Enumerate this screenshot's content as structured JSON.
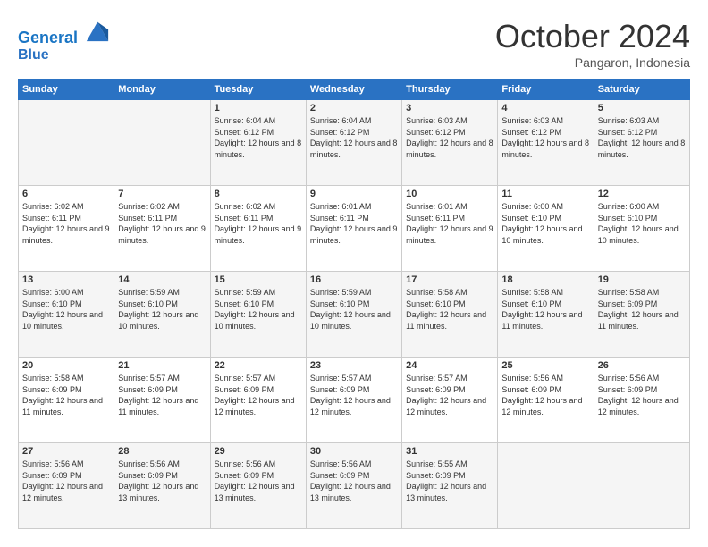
{
  "header": {
    "logo_line1": "General",
    "logo_line2": "Blue",
    "month": "October 2024",
    "location": "Pangaron, Indonesia"
  },
  "days_of_week": [
    "Sunday",
    "Monday",
    "Tuesday",
    "Wednesday",
    "Thursday",
    "Friday",
    "Saturday"
  ],
  "weeks": [
    [
      {
        "day": "",
        "sunrise": "",
        "sunset": "",
        "daylight": ""
      },
      {
        "day": "",
        "sunrise": "",
        "sunset": "",
        "daylight": ""
      },
      {
        "day": "1",
        "sunrise": "Sunrise: 6:04 AM",
        "sunset": "Sunset: 6:12 PM",
        "daylight": "Daylight: 12 hours and 8 minutes."
      },
      {
        "day": "2",
        "sunrise": "Sunrise: 6:04 AM",
        "sunset": "Sunset: 6:12 PM",
        "daylight": "Daylight: 12 hours and 8 minutes."
      },
      {
        "day": "3",
        "sunrise": "Sunrise: 6:03 AM",
        "sunset": "Sunset: 6:12 PM",
        "daylight": "Daylight: 12 hours and 8 minutes."
      },
      {
        "day": "4",
        "sunrise": "Sunrise: 6:03 AM",
        "sunset": "Sunset: 6:12 PM",
        "daylight": "Daylight: 12 hours and 8 minutes."
      },
      {
        "day": "5",
        "sunrise": "Sunrise: 6:03 AM",
        "sunset": "Sunset: 6:12 PM",
        "daylight": "Daylight: 12 hours and 8 minutes."
      }
    ],
    [
      {
        "day": "6",
        "sunrise": "Sunrise: 6:02 AM",
        "sunset": "Sunset: 6:11 PM",
        "daylight": "Daylight: 12 hours and 9 minutes."
      },
      {
        "day": "7",
        "sunrise": "Sunrise: 6:02 AM",
        "sunset": "Sunset: 6:11 PM",
        "daylight": "Daylight: 12 hours and 9 minutes."
      },
      {
        "day": "8",
        "sunrise": "Sunrise: 6:02 AM",
        "sunset": "Sunset: 6:11 PM",
        "daylight": "Daylight: 12 hours and 9 minutes."
      },
      {
        "day": "9",
        "sunrise": "Sunrise: 6:01 AM",
        "sunset": "Sunset: 6:11 PM",
        "daylight": "Daylight: 12 hours and 9 minutes."
      },
      {
        "day": "10",
        "sunrise": "Sunrise: 6:01 AM",
        "sunset": "Sunset: 6:11 PM",
        "daylight": "Daylight: 12 hours and 9 minutes."
      },
      {
        "day": "11",
        "sunrise": "Sunrise: 6:00 AM",
        "sunset": "Sunset: 6:10 PM",
        "daylight": "Daylight: 12 hours and 10 minutes."
      },
      {
        "day": "12",
        "sunrise": "Sunrise: 6:00 AM",
        "sunset": "Sunset: 6:10 PM",
        "daylight": "Daylight: 12 hours and 10 minutes."
      }
    ],
    [
      {
        "day": "13",
        "sunrise": "Sunrise: 6:00 AM",
        "sunset": "Sunset: 6:10 PM",
        "daylight": "Daylight: 12 hours and 10 minutes."
      },
      {
        "day": "14",
        "sunrise": "Sunrise: 5:59 AM",
        "sunset": "Sunset: 6:10 PM",
        "daylight": "Daylight: 12 hours and 10 minutes."
      },
      {
        "day": "15",
        "sunrise": "Sunrise: 5:59 AM",
        "sunset": "Sunset: 6:10 PM",
        "daylight": "Daylight: 12 hours and 10 minutes."
      },
      {
        "day": "16",
        "sunrise": "Sunrise: 5:59 AM",
        "sunset": "Sunset: 6:10 PM",
        "daylight": "Daylight: 12 hours and 10 minutes."
      },
      {
        "day": "17",
        "sunrise": "Sunrise: 5:58 AM",
        "sunset": "Sunset: 6:10 PM",
        "daylight": "Daylight: 12 hours and 11 minutes."
      },
      {
        "day": "18",
        "sunrise": "Sunrise: 5:58 AM",
        "sunset": "Sunset: 6:10 PM",
        "daylight": "Daylight: 12 hours and 11 minutes."
      },
      {
        "day": "19",
        "sunrise": "Sunrise: 5:58 AM",
        "sunset": "Sunset: 6:09 PM",
        "daylight": "Daylight: 12 hours and 11 minutes."
      }
    ],
    [
      {
        "day": "20",
        "sunrise": "Sunrise: 5:58 AM",
        "sunset": "Sunset: 6:09 PM",
        "daylight": "Daylight: 12 hours and 11 minutes."
      },
      {
        "day": "21",
        "sunrise": "Sunrise: 5:57 AM",
        "sunset": "Sunset: 6:09 PM",
        "daylight": "Daylight: 12 hours and 11 minutes."
      },
      {
        "day": "22",
        "sunrise": "Sunrise: 5:57 AM",
        "sunset": "Sunset: 6:09 PM",
        "daylight": "Daylight: 12 hours and 12 minutes."
      },
      {
        "day": "23",
        "sunrise": "Sunrise: 5:57 AM",
        "sunset": "Sunset: 6:09 PM",
        "daylight": "Daylight: 12 hours and 12 minutes."
      },
      {
        "day": "24",
        "sunrise": "Sunrise: 5:57 AM",
        "sunset": "Sunset: 6:09 PM",
        "daylight": "Daylight: 12 hours and 12 minutes."
      },
      {
        "day": "25",
        "sunrise": "Sunrise: 5:56 AM",
        "sunset": "Sunset: 6:09 PM",
        "daylight": "Daylight: 12 hours and 12 minutes."
      },
      {
        "day": "26",
        "sunrise": "Sunrise: 5:56 AM",
        "sunset": "Sunset: 6:09 PM",
        "daylight": "Daylight: 12 hours and 12 minutes."
      }
    ],
    [
      {
        "day": "27",
        "sunrise": "Sunrise: 5:56 AM",
        "sunset": "Sunset: 6:09 PM",
        "daylight": "Daylight: 12 hours and 12 minutes."
      },
      {
        "day": "28",
        "sunrise": "Sunrise: 5:56 AM",
        "sunset": "Sunset: 6:09 PM",
        "daylight": "Daylight: 12 hours and 13 minutes."
      },
      {
        "day": "29",
        "sunrise": "Sunrise: 5:56 AM",
        "sunset": "Sunset: 6:09 PM",
        "daylight": "Daylight: 12 hours and 13 minutes."
      },
      {
        "day": "30",
        "sunrise": "Sunrise: 5:56 AM",
        "sunset": "Sunset: 6:09 PM",
        "daylight": "Daylight: 12 hours and 13 minutes."
      },
      {
        "day": "31",
        "sunrise": "Sunrise: 5:55 AM",
        "sunset": "Sunset: 6:09 PM",
        "daylight": "Daylight: 12 hours and 13 minutes."
      },
      {
        "day": "",
        "sunrise": "",
        "sunset": "",
        "daylight": ""
      },
      {
        "day": "",
        "sunrise": "",
        "sunset": "",
        "daylight": ""
      }
    ]
  ]
}
